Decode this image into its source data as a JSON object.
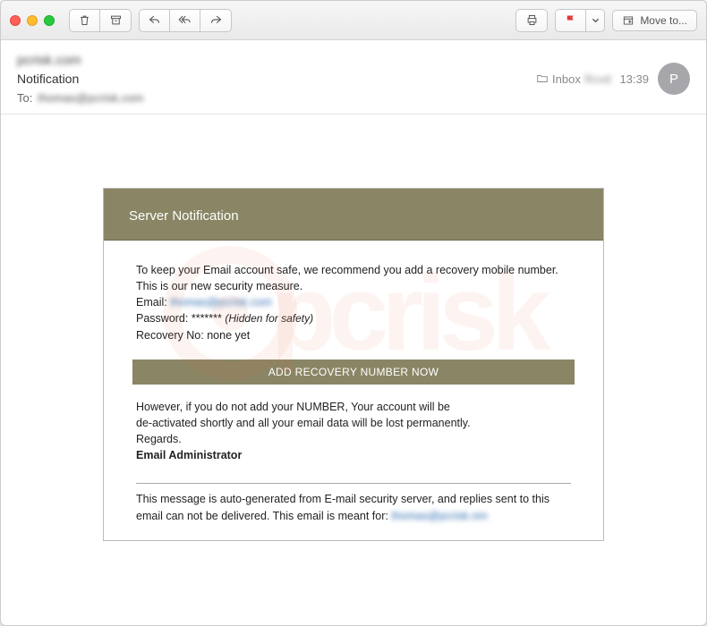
{
  "toolbar": {
    "move_to_label": "Move to..."
  },
  "header": {
    "sender": "pcrisk.com",
    "subject": "Notification",
    "to_label": "To:",
    "to_address": "thomas@pcrisk.com",
    "folder_label": "Inbox",
    "folder_extra": "Rcvd",
    "time": "13:39",
    "avatar_initial": "P"
  },
  "mail": {
    "heading": "Server Notification",
    "intro_line1": "To keep your Email account safe, we recommend you add a recovery mobile number.",
    "intro_line2": "This is our new security measure.",
    "email_label": "Email:",
    "email_value": "thomas@pcrisk.com",
    "password_label": "Password:",
    "password_masked": "*******",
    "password_note": "(Hidden for safety)",
    "recovery_label": "Recovery No:",
    "recovery_value": "none yet",
    "cta_label": "ADD RECOVERY NUMBER NOW",
    "warn_line1": "However, if you do not add your NUMBER, Your account will be",
    "warn_line2": "de-activated shortly and all your email data will be lost permanently.",
    "regards": "Regards.",
    "signature": "Email Administrator",
    "footnote_prefix": "This message is auto-generated from E-mail security server, and replies sent to this email can not be delivered. This email is meant for:",
    "footnote_email": "thomas@pcrisk.nm"
  },
  "watermark": "pcrisk"
}
